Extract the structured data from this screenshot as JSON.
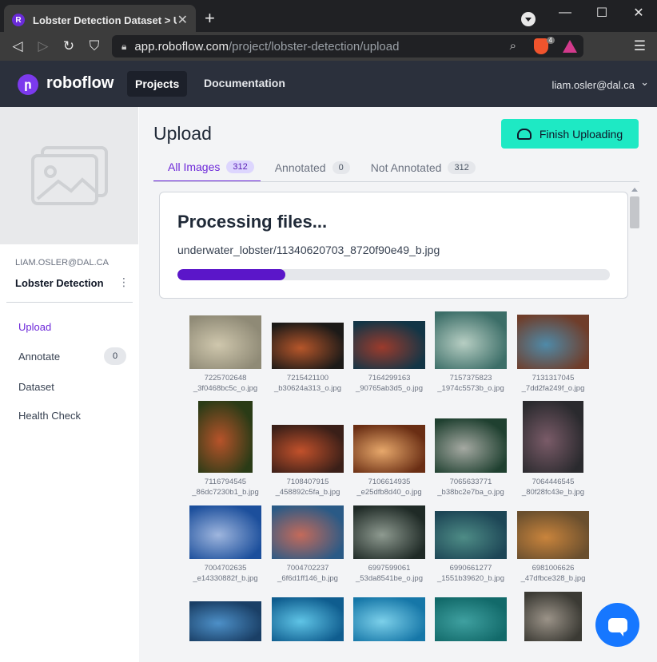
{
  "browser": {
    "tab_title": "Lobster Detection Dataset > Uplo",
    "url_host": "app.roboflow.com",
    "url_path": "/project/lobster-detection/upload",
    "brave_badge": "4"
  },
  "header": {
    "logo_text": "roboflow",
    "nav_projects": "Projects",
    "nav_docs": "Documentation",
    "user_email": "liam.osler@dal.ca"
  },
  "sidebar": {
    "workspace": "LIAM.OSLER@DAL.CA",
    "project_name": "Lobster Detection",
    "items": [
      {
        "label": "Upload"
      },
      {
        "label": "Annotate",
        "badge": "0"
      },
      {
        "label": "Dataset"
      },
      {
        "label": "Health Check"
      }
    ]
  },
  "main": {
    "title": "Upload",
    "finish_button": "Finish Uploading",
    "tabs": [
      {
        "label": "All Images",
        "count": "312"
      },
      {
        "label": "Annotated",
        "count": "0"
      },
      {
        "label": "Not Annotated",
        "count": "312"
      }
    ],
    "processing": {
      "title": "Processing files...",
      "file": "underwater_lobster/11340620703_8720f90e49_b.jpg",
      "progress": 0.25
    },
    "images": [
      {
        "l1": "7225702648",
        "l2": "_3f0468bc5c_o.jpg",
        "c1": "#8f8a76",
        "c2": "#cfc7ad"
      },
      {
        "l1": "7215421100",
        "l2": "_b30624a313_o.jpg",
        "c1": "#1c1a18",
        "c2": "#b6562a"
      },
      {
        "l1": "7164299163",
        "l2": "_90765ab3d5_o.jpg",
        "c1": "#123546",
        "c2": "#9c3b2c"
      },
      {
        "l1": "7157375823",
        "l2": "_1974c5573b_o.jpg",
        "c1": "#3c6e68",
        "c2": "#b7cec3"
      },
      {
        "l1": "7131317045",
        "l2": "_7dd2fa249f_o.jpg",
        "c1": "#6f3d2a",
        "c2": "#4f8aa8"
      },
      {
        "l1": "7116794545",
        "l2": "_86dc7230b1_b.jpg",
        "c1": "#2a3b16",
        "c2": "#b7532a"
      },
      {
        "l1": "7108407915",
        "l2": "_458892c5fa_b.jpg",
        "c1": "#3a1f18",
        "c2": "#c2512b"
      },
      {
        "l1": "7106614935",
        "l2": "_e25dfb8d40_o.jpg",
        "c1": "#6a2e14",
        "c2": "#e7a86b"
      },
      {
        "l1": "7065633771",
        "l2": "_b38bc2e7ba_o.jpg",
        "c1": "#1f4030",
        "c2": "#a5a9a2"
      },
      {
        "l1": "7064446545",
        "l2": "_80f28fc43e_b.jpg",
        "c1": "#2a2a2e",
        "c2": "#7a5b68"
      },
      {
        "l1": "7004702635",
        "l2": "_e14330882f_b.jpg",
        "c1": "#1c4f9c",
        "c2": "#9fb6de"
      },
      {
        "l1": "7004702237",
        "l2": "_6f6d1ff146_b.jpg",
        "c1": "#2a5a86",
        "c2": "#c46a5a"
      },
      {
        "l1": "6997599061",
        "l2": "_53da8541be_o.jpg",
        "c1": "#1f2a26",
        "c2": "#8e9a90"
      },
      {
        "l1": "6990661277",
        "l2": "_1551b39620_b.jpg",
        "c1": "#1d4656",
        "c2": "#4e8c86"
      },
      {
        "l1": "6981006626",
        "l2": "_47dfbce328_b.jpg",
        "c1": "#6a4f2e",
        "c2": "#c9843c"
      },
      {
        "l1": "",
        "l2": "",
        "c1": "#1a3f66",
        "c2": "#4d90c8"
      },
      {
        "l1": "",
        "l2": "",
        "c1": "#0f5d8f",
        "c2": "#5fc4e6"
      },
      {
        "l1": "",
        "l2": "",
        "c1": "#1677a8",
        "c2": "#7cd0ea"
      },
      {
        "l1": "",
        "l2": "",
        "c1": "#126a6a",
        "c2": "#3fa0a0"
      },
      {
        "l1": "",
        "l2": "",
        "c1": "#3b3a34",
        "c2": "#9b9388"
      }
    ]
  },
  "colors": {
    "accent": "#6d28d9",
    "finish_button": "#1ee9c4",
    "header_bg": "#2b303c"
  }
}
